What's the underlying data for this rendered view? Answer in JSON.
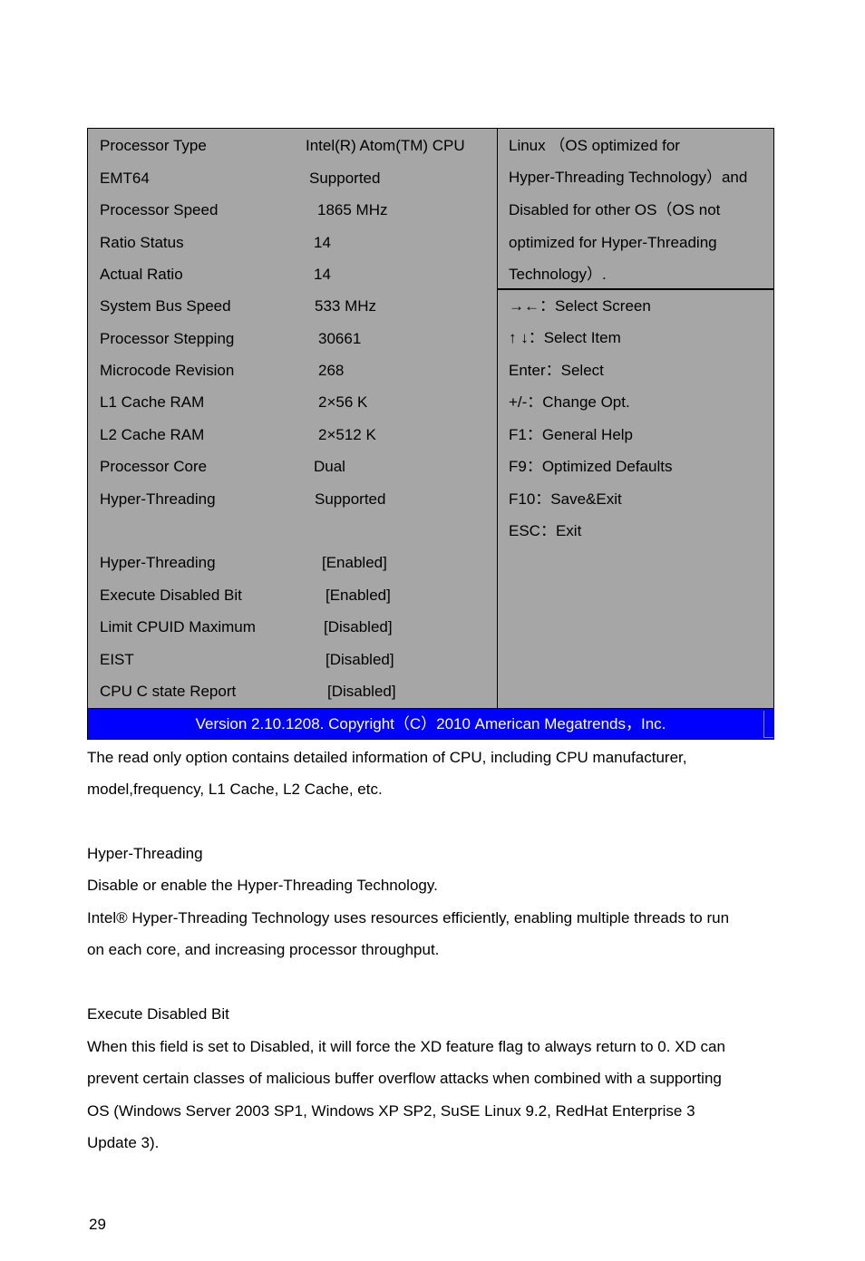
{
  "bios": {
    "info_rows": [
      {
        "label": "Processor Type",
        "value": "Intel(R) Atom(TM) CPU"
      },
      {
        "label": "EMT64",
        "value": "Supported"
      },
      {
        "label": "Processor Speed",
        "value": "1865 MHz"
      },
      {
        "label": "Ratio Status",
        "value": "14"
      },
      {
        "label": "Actual Ratio",
        "value": "14"
      },
      {
        "label": "System Bus Speed",
        "value": "533 MHz"
      },
      {
        "label": "Processor Stepping",
        "value": "30661"
      },
      {
        "label": "Microcode Revision",
        "value": "268"
      },
      {
        "label": "L1 Cache RAM",
        "value": "2×56 K"
      },
      {
        "label": "L2 Cache RAM",
        "value": "2×512 K"
      },
      {
        "label": "Processor Core",
        "value": "Dual"
      },
      {
        "label": "Hyper-Threading",
        "value": "Supported"
      }
    ],
    "option_rows": [
      {
        "label": "Hyper-Threading",
        "value": "[Enabled]"
      },
      {
        "label": "Execute Disabled Bit",
        "value": "[Enabled]"
      },
      {
        "label": "Limit CPUID Maximum",
        "value": "[Disabled]"
      },
      {
        "label": "EIST",
        "value": "[Disabled]"
      },
      {
        "label": "CPU C state Report",
        "value": "[Disabled]"
      }
    ],
    "help_lines": [
      "Linux （OS optimized for",
      "Hyper-Threading Technology）and",
      "Disabled for other OS（OS not",
      "optimized for Hyper-Threading",
      "Technology）."
    ],
    "key_lines": [
      "→←：Select Screen",
      "↑ ↓：Select Item",
      "Enter：Select",
      "+/-：Change Opt.",
      "F1：General Help",
      "F9：Optimized Defaults",
      "F10：Save&Exit",
      "ESC：Exit"
    ],
    "footer": "Version 2.10.1208. Copyright（C）2010 American Megatrends，Inc.",
    "colors": {
      "panel": "#a6a6a6",
      "footer": "#0000fe"
    }
  },
  "document": {
    "paragraphs": [
      "The read only option contains detailed information of CPU, including CPU manufacturer,",
      "model,frequency, L1 Cache, L2 Cache, etc.",
      "Hyper-Threading",
      "Disable or enable the Hyper-Threading Technology.",
      "Intel® Hyper-Threading Technology uses resources efficiently, enabling multiple threads to run",
      "on each core, and increasing processor throughput.",
      "Execute Disabled Bit",
      "When this field is set to Disabled, it will force the XD feature flag to always return to 0. XD can",
      "prevent certain classes of malicious buffer overflow attacks when combined with a supporting",
      "OS (Windows Server 2003 SP1, Windows XP SP2, SuSE Linux 9.2, RedHat Enterprise 3",
      "Update 3)."
    ],
    "page_number": "29"
  }
}
